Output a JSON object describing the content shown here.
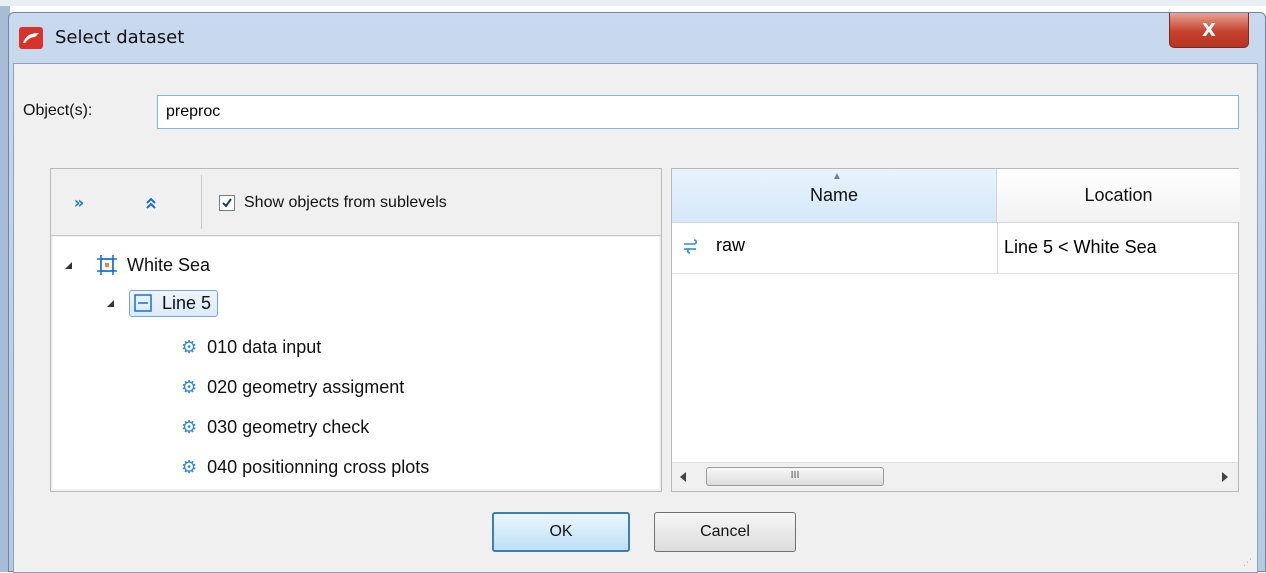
{
  "window": {
    "title": "Select dataset",
    "close_glyph": "X"
  },
  "objects": {
    "label": "Object(s):",
    "value": "preproc"
  },
  "toolbar": {
    "expand_glyph": "»",
    "collapse_glyph": "⌃",
    "show_sublevels_label": "Show objects from sublevels",
    "show_sublevels_checked": true
  },
  "tree": {
    "root": {
      "label": "White Sea",
      "icon": "survey-area-icon"
    },
    "line": {
      "label": "Line 5",
      "icon": "line-icon"
    },
    "flows": [
      {
        "label": "010 data input",
        "icon": "gear-icon"
      },
      {
        "label": "020 geometry assigment",
        "icon": "gear-icon"
      },
      {
        "label": "030 geometry check",
        "icon": "gear-icon"
      },
      {
        "label": "040 positionning cross plots",
        "icon": "gear-icon"
      }
    ]
  },
  "table": {
    "columns": [
      "Name",
      "Location"
    ],
    "rows": [
      {
        "name": "raw",
        "location": "Line 5 < White Sea",
        "icon": "dataset-icon"
      }
    ],
    "scroll_thumb_glyph": "III"
  },
  "buttons": {
    "ok": "OK",
    "cancel": "Cancel"
  },
  "colors": {
    "accent": "#1a6fd1",
    "app_icon": "#d9322a",
    "close_button": "#c6412c"
  }
}
